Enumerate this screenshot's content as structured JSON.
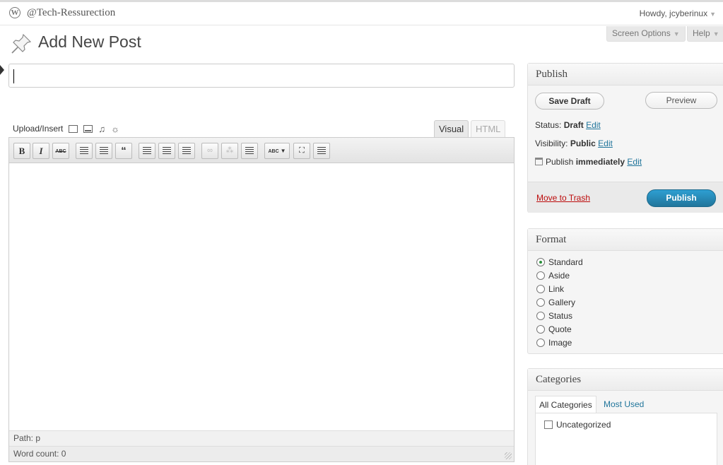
{
  "adminbar": {
    "site_name": "@Tech-Ressurection",
    "howdy": "Howdy, jcyberinux"
  },
  "screen_options": "Screen Options",
  "help": "Help",
  "page": {
    "title": "Add New Post"
  },
  "title_input": {
    "value": ""
  },
  "media": {
    "upload_insert": "Upload/Insert"
  },
  "editor_tabs": {
    "visual": "Visual",
    "html": "HTML"
  },
  "toolbar": {
    "bold": "B",
    "italic": "I",
    "strike": "ABC",
    "quote": "“",
    "spell": "ABC"
  },
  "status_bar": {
    "path": "Path: p",
    "word_count": "Word count: 0"
  },
  "publish": {
    "title": "Publish",
    "save_draft": "Save Draft",
    "preview": "Preview",
    "status_label": "Status:",
    "status_value": "Draft",
    "visibility_label": "Visibility:",
    "visibility_value": "Public",
    "publish_label": "Publish",
    "publish_value": "immediately",
    "edit": "Edit",
    "move_to_trash": "Move to Trash",
    "publish_button": "Publish"
  },
  "format": {
    "title": "Format",
    "options": [
      "Standard",
      "Aside",
      "Link",
      "Gallery",
      "Status",
      "Quote",
      "Image"
    ],
    "selected": "Standard"
  },
  "categories": {
    "title": "Categories",
    "tab_all": "All Categories",
    "tab_used": "Most Used",
    "items": [
      "Uncategorized"
    ]
  }
}
